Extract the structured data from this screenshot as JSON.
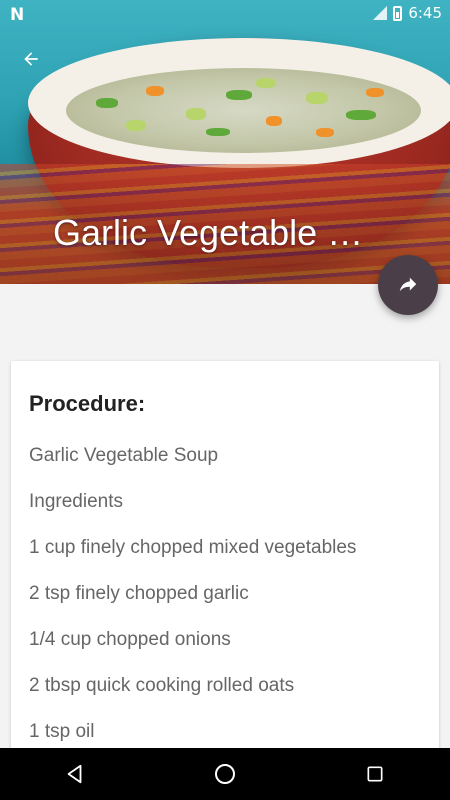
{
  "status_bar": {
    "time": "6:45",
    "left_icon": "N"
  },
  "header": {
    "title": "Garlic Vegetable S…"
  },
  "card": {
    "heading": "Procedure:",
    "lines": [
      "Garlic Vegetable Soup",
      "Ingredients",
      "1 cup finely chopped mixed vegetables",
      "2 tsp finely chopped garlic",
      "1/4 cup chopped onions",
      "2 tbsp quick cooking rolled oats",
      "1 tsp oil"
    ]
  },
  "icons": {
    "back": "arrow-back-icon",
    "share": "share-icon",
    "nav_back": "triangle-back-icon",
    "nav_home": "circle-home-icon",
    "nav_recents": "square-recents-icon"
  },
  "colors": {
    "fab": "#4a3f48",
    "navbar": "#000000",
    "card_bg": "#ffffff"
  }
}
